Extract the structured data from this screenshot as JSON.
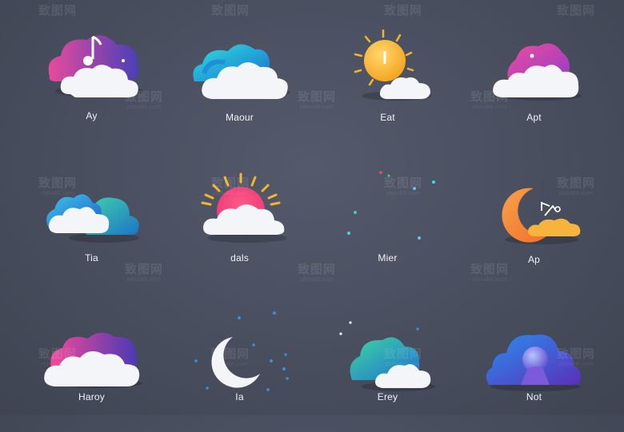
{
  "labels": [
    "Ay",
    "Maour",
    "Eat",
    "Apt",
    "Tia",
    "dals",
    "Mier",
    "Ap",
    "Haroy",
    "Ia",
    "Erey",
    "Not"
  ],
  "watermark": {
    "text": "致图网",
    "sub": "zhitu88.com"
  },
  "colors": {
    "background": "#4a5060",
    "cloud_white": "#f4f5f8",
    "pink": "#e64b9c",
    "purple": "#5a3fb8",
    "teal": "#19b8d4",
    "yellow": "#f6c22a",
    "orange": "#f38a2e",
    "green": "#2fc79b"
  },
  "icons": [
    "cloud-music-icon",
    "teal-cloud-icon",
    "sun-cloud-icon",
    "pink-cloud-icon",
    "teal-double-cloud-icon",
    "sunrise-cloud-icon",
    "crescent-moon-rain-icon",
    "moon-cloud-icon",
    "purple-cloud-icon",
    "white-moon-rain-icon",
    "green-cloud-icon",
    "night-cloud-orb-icon"
  ]
}
